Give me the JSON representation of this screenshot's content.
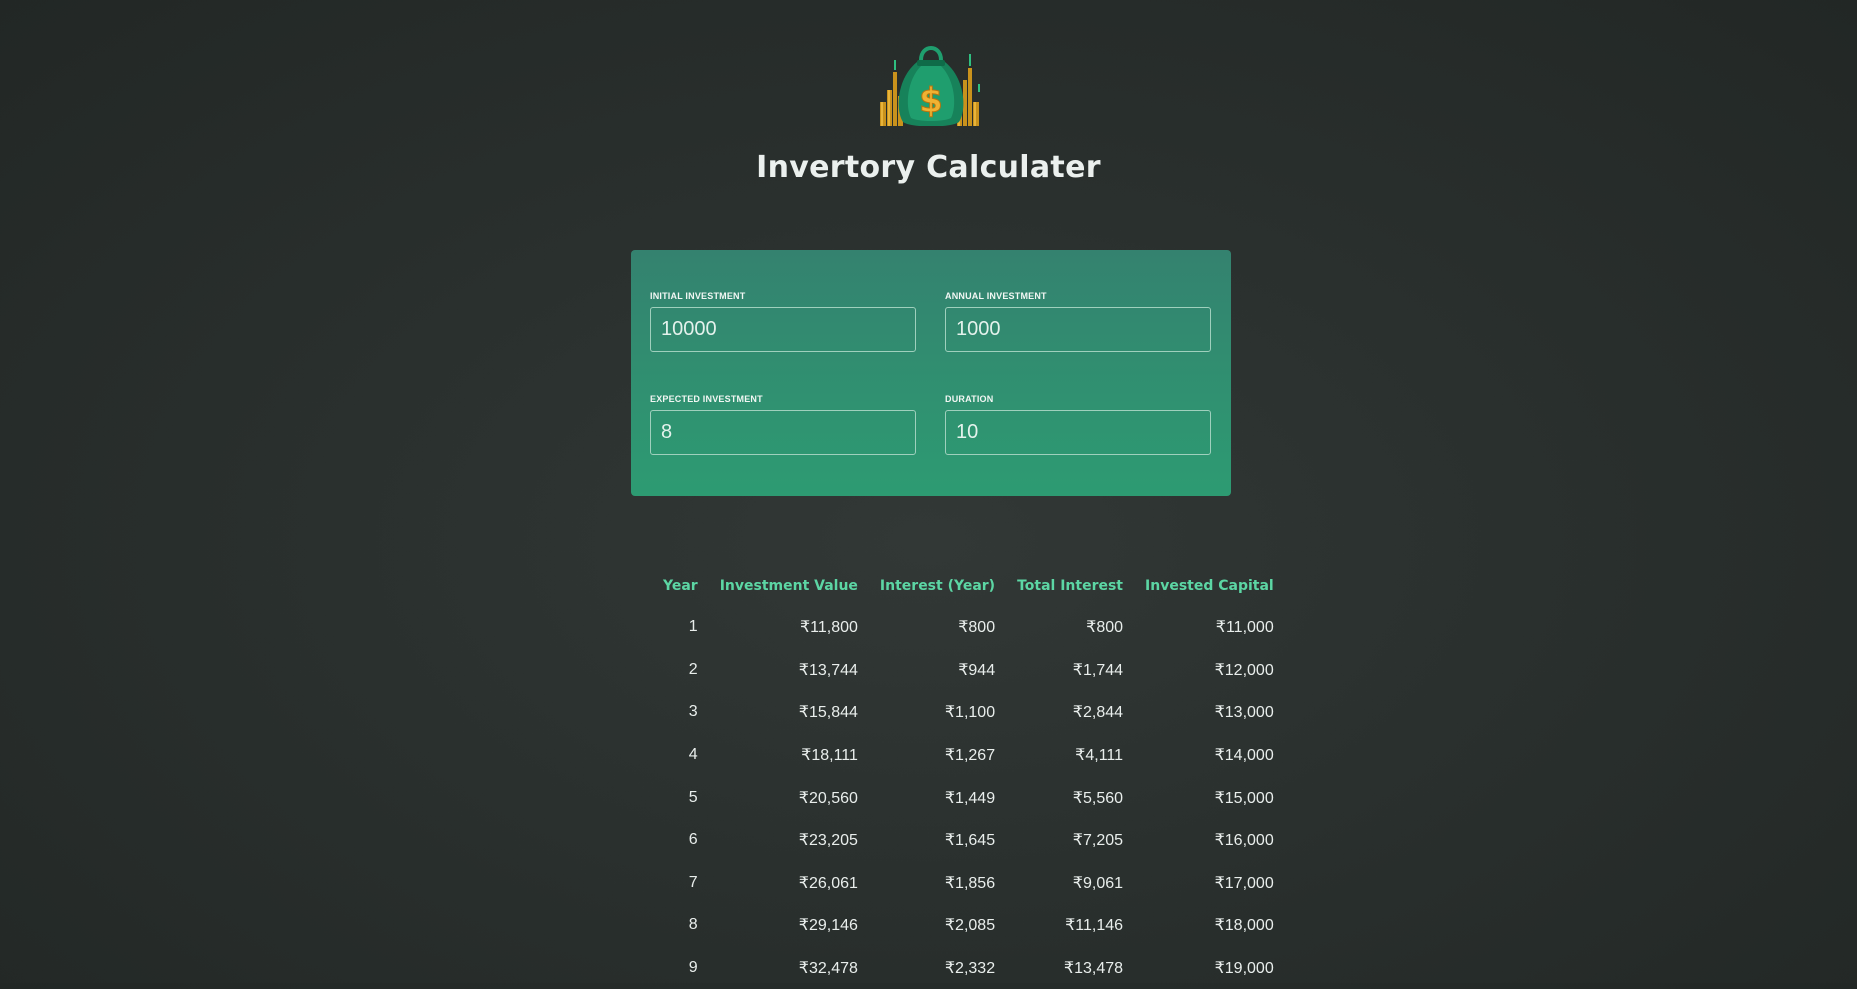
{
  "app": {
    "title": "Invertory Calculater",
    "logo_icon": "money-bag-icon"
  },
  "inputs": {
    "initial_investment": {
      "label": "INITIAL INVESTMENT",
      "value": "10000"
    },
    "annual_investment": {
      "label": "ANNUAL INVESTMENT",
      "value": "1000"
    },
    "expected_investment": {
      "label": "EXPECTED INVESTMENT",
      "value": "8"
    },
    "duration": {
      "label": "DURATION",
      "value": "10"
    }
  },
  "table": {
    "headers": [
      "Year",
      "Investment Value",
      "Interest (Year)",
      "Total Interest",
      "Invested Capital"
    ],
    "rows": [
      [
        "1",
        "₹11,800",
        "₹800",
        "₹800",
        "₹11,000"
      ],
      [
        "2",
        "₹13,744",
        "₹944",
        "₹1,744",
        "₹12,000"
      ],
      [
        "3",
        "₹15,844",
        "₹1,100",
        "₹2,844",
        "₹13,000"
      ],
      [
        "4",
        "₹18,111",
        "₹1,267",
        "₹4,111",
        "₹14,000"
      ],
      [
        "5",
        "₹20,560",
        "₹1,449",
        "₹5,560",
        "₹15,000"
      ],
      [
        "6",
        "₹23,205",
        "₹1,645",
        "₹7,205",
        "₹16,000"
      ],
      [
        "7",
        "₹26,061",
        "₹1,856",
        "₹9,061",
        "₹17,000"
      ],
      [
        "8",
        "₹29,146",
        "₹2,085",
        "₹11,146",
        "₹18,000"
      ],
      [
        "9",
        "₹32,478",
        "₹2,332",
        "₹13,478",
        "₹19,000"
      ]
    ]
  },
  "colors": {
    "background": "#2a302e",
    "panel_top": "#34826f",
    "panel_bottom": "#2d9b72",
    "table_header": "#5cd6a4"
  }
}
